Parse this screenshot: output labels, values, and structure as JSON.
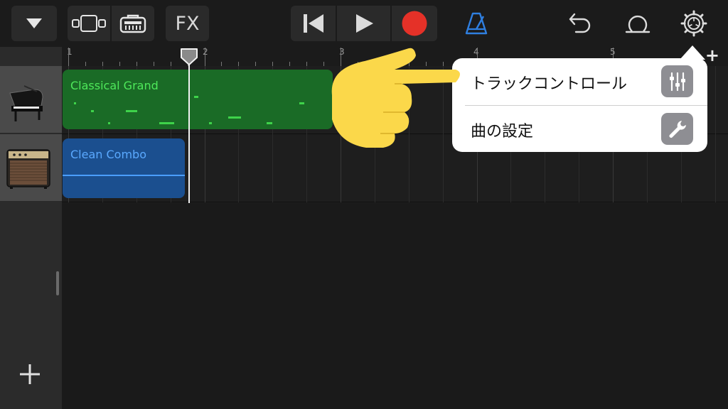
{
  "toolbar": {
    "fx_label": "FX",
    "icons": [
      "tracks-dropdown-icon",
      "view-toggle-icon",
      "smart-controls-icon",
      "rewind-icon",
      "play-icon",
      "record-icon",
      "metronome-icon",
      "undo-icon",
      "loop-icon",
      "settings-icon"
    ]
  },
  "ruler": {
    "bars": [
      "1",
      "2",
      "3",
      "4",
      "5"
    ],
    "add_label": "+"
  },
  "tracks": [
    {
      "region_label": "Classical Grand",
      "instrument_icon": "grand-piano-icon",
      "color": "#1a6b26",
      "label_color": "#4ee85a"
    },
    {
      "region_label": "Clean Combo",
      "instrument_icon": "guitar-amp-icon",
      "color": "#1b4f8f",
      "label_color": "#5aa9ff"
    }
  ],
  "add_track_label": "+",
  "popover": {
    "items": [
      {
        "label": "トラックコントロール",
        "icon": "sliders-icon"
      },
      {
        "label": "曲の設定",
        "icon": "wrench-icon"
      }
    ]
  },
  "colors": {
    "record": "#e53128",
    "metronome": "#2f7fe0",
    "hand": "#fbd84a"
  }
}
